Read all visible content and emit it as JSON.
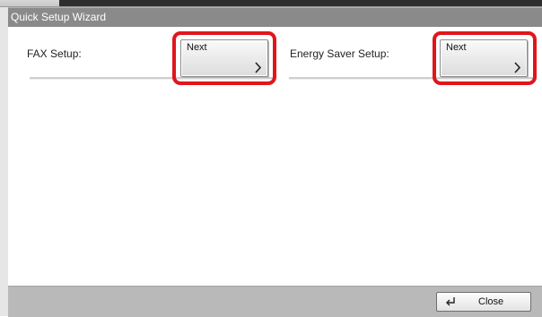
{
  "window": {
    "title": "Quick Setup Wizard"
  },
  "rows": [
    {
      "label": "FAX Setup:",
      "button_label": "Next"
    },
    {
      "label": "Energy Saver Setup:",
      "button_label": "Next"
    }
  ],
  "footer": {
    "close_label": "Close"
  },
  "icons": {
    "next_chevron": "chevron-right-icon",
    "close": "enter-return-icon"
  },
  "colors": {
    "highlight": "#e0161b",
    "titlebar": "#8a8a8a",
    "footer": "#b9b9b9"
  }
}
